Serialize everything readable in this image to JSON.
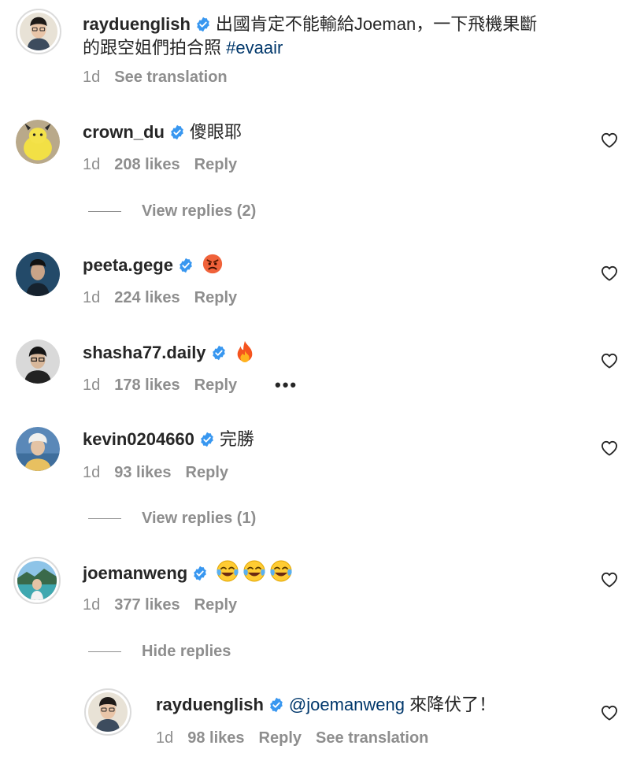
{
  "caption": {
    "username": "rayduenglish",
    "text_line1": "出國肯定不能輸給Joeman，一下飛機果斷",
    "text_line2": "的跟空姐們拍合照",
    "hashtag": "#evaair",
    "time": "1d",
    "translate": "See translation"
  },
  "comments": [
    {
      "username": "crown_du",
      "text": "傻眼耶",
      "time": "1d",
      "likes": "208 likes",
      "reply": "Reply",
      "view_replies": "View replies (2)"
    },
    {
      "username": "peeta.gege",
      "emoji": "pouting-face",
      "time": "1d",
      "likes": "224 likes",
      "reply": "Reply"
    },
    {
      "username": "shasha77.daily",
      "emoji": "fire",
      "time": "1d",
      "likes": "178 likes",
      "reply": "Reply",
      "more": "•••"
    },
    {
      "username": "kevin0204660",
      "text": "完勝",
      "time": "1d",
      "likes": "93 likes",
      "reply": "Reply",
      "view_replies": "View replies (1)"
    },
    {
      "username": "joemanweng",
      "emoji": "tears-of-joy x3",
      "time": "1d",
      "likes": "377 likes",
      "reply": "Reply",
      "hide_replies": "Hide replies"
    }
  ],
  "reply": {
    "username": "rayduenglish",
    "mention": "@joemanweng",
    "text": " 來降伏了！",
    "time": "1d",
    "likes": "98 likes",
    "reply": "Reply",
    "translate": "See translation"
  },
  "colors": {
    "text": "#262626",
    "meta": "#8e8e8e",
    "link": "#00376b",
    "verified": "#3897f0"
  }
}
